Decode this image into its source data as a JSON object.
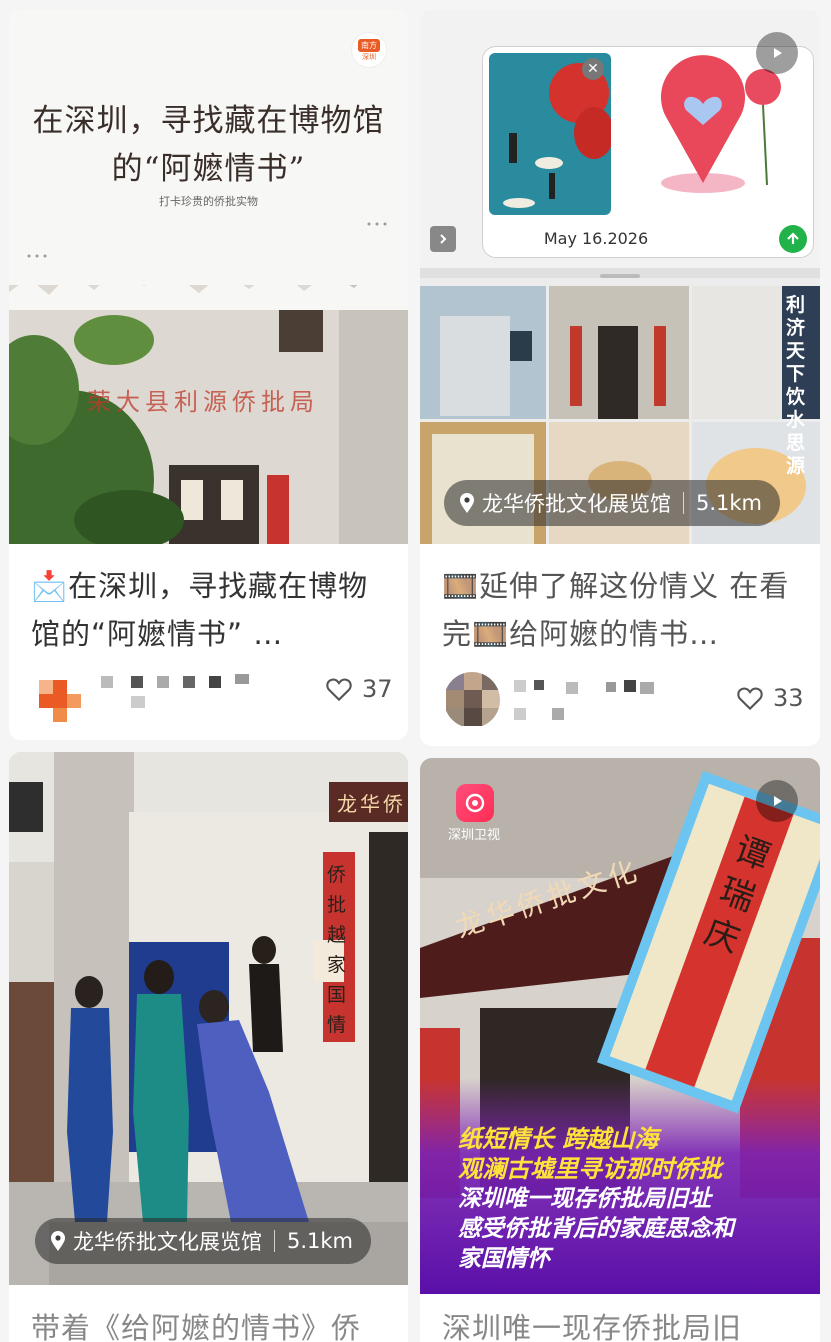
{
  "cards": [
    {
      "cover": {
        "headline_line1": "在深圳，寻找藏在博物馆",
        "headline_line2": "的“阿嬷情书”",
        "subhead": "打卡珍贵的侨批实物",
        "badge_top": "南方",
        "badge_bottom": "深圳",
        "sign_text": "荣大县利源侨批局"
      },
      "title": "📩在深圳，寻找藏在博物馆的“阿嬷情书”  …",
      "likes": "37",
      "like_icon": "heart-outline-icon"
    },
    {
      "cover": {
        "date_text": "May 16.2026",
        "side_text": "利济天下饮水思源",
        "location": "龙华侨批文化展览馆",
        "distance": "5.1km"
      },
      "title": "🎞️延伸了解这份情义 在看完🎞️给阿嬷的情书…",
      "likes": "33",
      "like_icon": "heart-outline-icon"
    },
    {
      "cover": {
        "sign_text": "龙华侨",
        "banner_text": "侨批越家国情",
        "location": "龙华侨批文化展览馆",
        "distance": "5.1km"
      },
      "title": "带着《给阿嬷的情书》侨"
    },
    {
      "cover": {
        "channel": "深圳卫视",
        "sign_text": "龙华侨批文化",
        "letter_name": "谭瑞庆",
        "caption_line1": "纸短情长  跨越山海",
        "caption_line2": "观澜古墟里寻访那时侨批",
        "caption_line3": "深圳唯一现存侨批局旧址",
        "caption_line4": "感受侨批背后的家庭思念和",
        "caption_line5": "家国情怀"
      },
      "title": "深圳唯一现存侨批局旧"
    }
  ],
  "colors": {
    "accent_red": "#c0392b",
    "caption_yellow": "#ffe23a",
    "caption_purple": "#6b1fb0",
    "heart_pink": "#e9475a"
  }
}
